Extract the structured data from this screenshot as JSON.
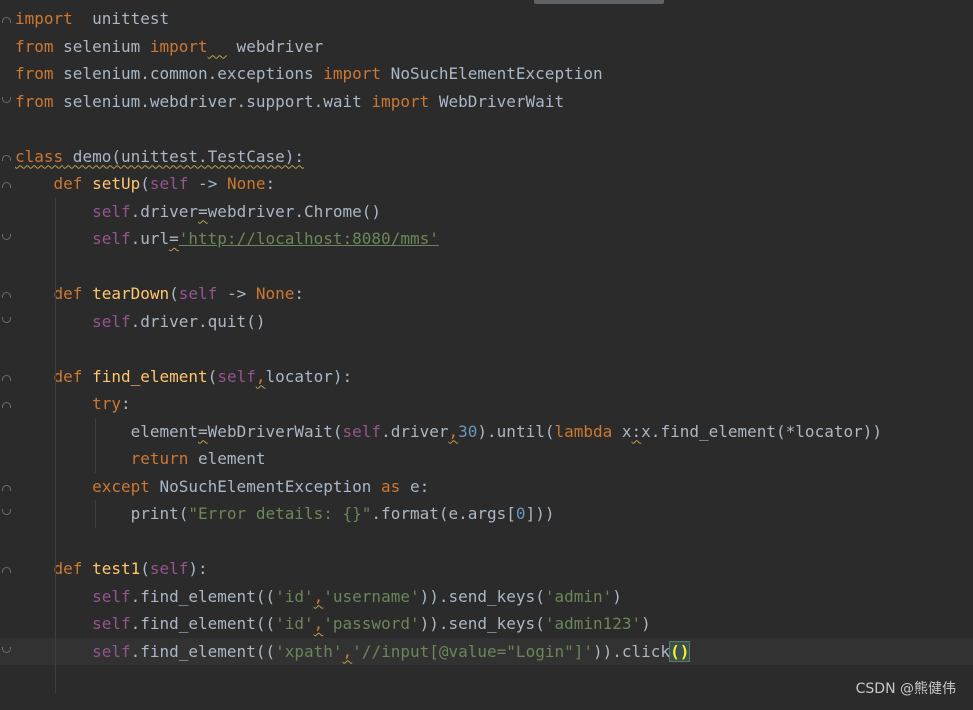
{
  "watermark": "CSDN @熊健伟",
  "lines": [
    [
      "import unittest"
    ],
    [
      "from selenium import  webdriver"
    ],
    [
      "from selenium.common.exceptions import NoSuchElementException"
    ],
    [
      "from selenium.webdriver.support.wait import WebDriverWait"
    ],
    [
      ""
    ],
    [
      "class demo(unittest.TestCase):"
    ],
    [
      "    def setUp(self) -> None:"
    ],
    [
      "        self.driver=webdriver.Chrome()"
    ],
    [
      "        self.url='http://localhost:8080/mms'"
    ],
    [
      ""
    ],
    [
      "    def tearDown(self) -> None:"
    ],
    [
      "        self.driver.quit()"
    ],
    [
      ""
    ],
    [
      "    def find_element(self,locator):"
    ],
    [
      "        try:"
    ],
    [
      "            element=WebDriverWait(self.driver,30).until(lambda x:x.find_element(*locator))"
    ],
    [
      "            return element"
    ],
    [
      "        except NoSuchElementException as e:"
    ],
    [
      "            print(\"Error details: {}\".format(e.args[0]))"
    ],
    [
      ""
    ],
    [
      "    def test1(self):"
    ],
    [
      "        self.find_element(('id','username')).send_keys('admin')"
    ],
    [
      "        self.find_element(('id','password')).send_keys('admin123')"
    ],
    [
      "        self.find_element(('xpath','//input[@value=\"Login\"]')).click()"
    ],
    [
      ""
    ]
  ],
  "tokens": {
    "l0": [
      [
        "kw",
        "import"
      ],
      [
        "",
        "  unittest"
      ]
    ],
    "l1": [
      [
        "kw",
        "from"
      ],
      [
        "",
        " selenium "
      ],
      [
        "kw",
        "import"
      ],
      [
        "warn",
        "  "
      ],
      [
        "",
        " webdriver"
      ]
    ],
    "l2": [
      [
        "kw",
        "from"
      ],
      [
        "",
        " selenium.common.exceptions "
      ],
      [
        "kw",
        "import"
      ],
      [
        "",
        " NoSuchElementException"
      ]
    ],
    "l3": [
      [
        "kw",
        "from"
      ],
      [
        "",
        " selenium.webdriver.support.wait "
      ],
      [
        "kw",
        "import"
      ],
      [
        "",
        " WebDriverWait"
      ]
    ],
    "l5": [
      [
        "kw warn",
        "class"
      ],
      [
        "warn",
        " demo(unittest.TestCase):"
      ]
    ],
    "l6": [
      [
        "",
        "    "
      ],
      [
        "kw",
        "def"
      ],
      [
        "",
        " "
      ],
      [
        "fn",
        "setUp"
      ],
      [
        "",
        "("
      ],
      [
        "self",
        "self"
      ],
      [
        "",
        " -> "
      ],
      [
        "kw",
        "None"
      ],
      [
        "",
        ":"
      ]
    ],
    "l7": [
      [
        "",
        "        "
      ],
      [
        "self",
        "self"
      ],
      [
        "",
        ".driver"
      ],
      [
        "warn",
        "="
      ],
      [
        "",
        "webdriver.Chrome()"
      ]
    ],
    "l8": [
      [
        "",
        "        "
      ],
      [
        "self",
        "self"
      ],
      [
        "",
        ".url"
      ],
      [
        "warn",
        "="
      ],
      [
        "url",
        "'http://localhost:8080/mms'"
      ]
    ],
    "l10": [
      [
        "",
        "    "
      ],
      [
        "kw",
        "def"
      ],
      [
        "",
        " "
      ],
      [
        "fn",
        "tearDown"
      ],
      [
        "",
        "("
      ],
      [
        "self",
        "self"
      ],
      [
        "",
        " -> "
      ],
      [
        "kw",
        "None"
      ],
      [
        "",
        ":"
      ]
    ],
    "l11": [
      [
        "",
        "        "
      ],
      [
        "self",
        "self"
      ],
      [
        "",
        ".driver.quit()"
      ]
    ],
    "l13": [
      [
        "",
        "    "
      ],
      [
        "kw",
        "def"
      ],
      [
        "",
        " "
      ],
      [
        "fn",
        "find_element"
      ],
      [
        "",
        "("
      ],
      [
        "self",
        "self"
      ],
      [
        "warn kw",
        ","
      ],
      [
        "",
        "locator):"
      ]
    ],
    "l14": [
      [
        "",
        "        "
      ],
      [
        "kw",
        "try"
      ],
      [
        "",
        ":"
      ]
    ],
    "l15": [
      [
        "",
        "            element"
      ],
      [
        "warn",
        "="
      ],
      [
        "",
        "WebDriverWait("
      ],
      [
        "self",
        "self"
      ],
      [
        "",
        ".driver"
      ],
      [
        "warn kw",
        ","
      ],
      [
        "num",
        "30"
      ],
      [
        "",
        ").until("
      ],
      [
        "kw",
        "lambda"
      ],
      [
        "",
        " x"
      ],
      [
        "warn",
        ":"
      ],
      [
        "",
        "x.find_element(*locator))"
      ]
    ],
    "l16": [
      [
        "",
        "            "
      ],
      [
        "kw",
        "return"
      ],
      [
        "",
        " element"
      ]
    ],
    "l17": [
      [
        "",
        "        "
      ],
      [
        "kw",
        "except"
      ],
      [
        "",
        " NoSuchElementException "
      ],
      [
        "kw",
        "as"
      ],
      [
        "",
        " e:"
      ]
    ],
    "l18": [
      [
        "",
        "            print("
      ],
      [
        "str",
        "\"Error details: {}\""
      ],
      [
        "",
        ".format(e.args["
      ],
      [
        "num",
        "0"
      ],
      [
        "",
        "]))"
      ]
    ],
    "l20": [
      [
        "",
        "    "
      ],
      [
        "kw",
        "def"
      ],
      [
        "",
        " "
      ],
      [
        "fn",
        "test1"
      ],
      [
        "",
        "("
      ],
      [
        "self",
        "self"
      ],
      [
        "",
        "):"
      ]
    ],
    "l21": [
      [
        "",
        "        "
      ],
      [
        "self",
        "self"
      ],
      [
        "",
        ".find_element(("
      ],
      [
        "str",
        "'id'"
      ],
      [
        "warn kw",
        ","
      ],
      [
        "str",
        "'username'"
      ],
      [
        "",
        ")).send_keys("
      ],
      [
        "str",
        "'admin'"
      ],
      [
        "",
        ")"
      ]
    ],
    "l22": [
      [
        "",
        "        "
      ],
      [
        "self",
        "self"
      ],
      [
        "",
        ".find_element(("
      ],
      [
        "str",
        "'id'"
      ],
      [
        "warn kw",
        ","
      ],
      [
        "str",
        "'password'"
      ],
      [
        "",
        ")).send_keys("
      ],
      [
        "str",
        "'admin123'"
      ],
      [
        "",
        ")"
      ]
    ],
    "l23": [
      [
        "",
        "        "
      ],
      [
        "self",
        "self"
      ],
      [
        "",
        ".find_element(("
      ],
      [
        "str",
        "'xpath'"
      ],
      [
        "warn kw",
        ","
      ],
      [
        "str",
        "'//input[@value=\"Login\"]'"
      ],
      [
        "",
        "))"
      ],
      [
        "",
        ".click"
      ],
      [
        "paren-match",
        "()"
      ]
    ]
  },
  "colors": {
    "background": "#2b2b2b",
    "keyword": "#cc7832",
    "self": "#94558d",
    "function": "#ffc66d",
    "string": "#6a8759",
    "number": "#6897bb",
    "default": "#a9b7c6"
  }
}
